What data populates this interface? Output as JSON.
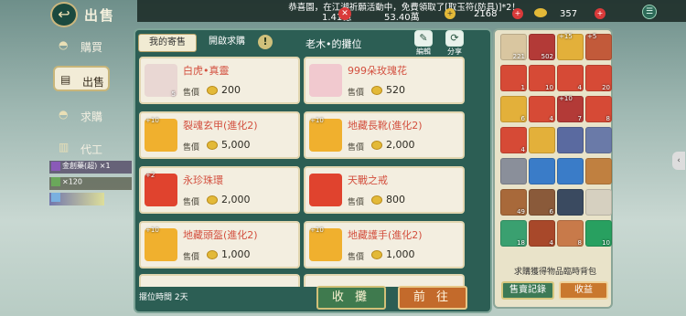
{
  "top": {
    "notice": "恭喜園，在江湖祈願活動中，免費領取了[取玉符(防具)]*2！",
    "currencies": [
      {
        "name": "silver",
        "value": "1.41億"
      },
      {
        "name": "copper",
        "value": "53.40萬"
      },
      {
        "name": "jade",
        "value": "2168"
      },
      {
        "name": "gold",
        "value": "357"
      }
    ]
  },
  "title": "出售",
  "nav": [
    {
      "label": "購買",
      "icon": "bowl-icon"
    },
    {
      "label": "出售",
      "icon": "register-icon"
    },
    {
      "label": "求購",
      "icon": "bowl-icon"
    },
    {
      "label": "代工",
      "icon": "anvil-icon"
    }
  ],
  "side_items": [
    {
      "label": "金創藥(超) ×1"
    },
    {
      "label": "×120"
    }
  ],
  "tabs": {
    "mine": "我的寄售",
    "open": "開啟求購"
  },
  "stall_title": "老木•的攤位",
  "edit_label": "編輯",
  "share_label": "分享",
  "price_label": "售價",
  "listings": [
    {
      "name": "白虎•真靈",
      "price": "200",
      "qty": "5",
      "plus": "",
      "color": "#e9d7d3"
    },
    {
      "name": "999朵玫瑰花",
      "price": "520",
      "qty": "",
      "plus": "",
      "color": "#f1c9cf"
    },
    {
      "name": "裂魂玄甲(進化2)",
      "price": "5,000",
      "qty": "",
      "plus": "+10",
      "color": "#f0b02e"
    },
    {
      "name": "地藏長靴(進化2)",
      "price": "2,000",
      "qty": "",
      "plus": "+10",
      "color": "#f0b02e"
    },
    {
      "name": "永珍珠環",
      "price": "2,000",
      "qty": "",
      "plus": "+2",
      "color": "#e0432e"
    },
    {
      "name": "天戰之戒",
      "price": "800",
      "qty": "",
      "plus": "",
      "color": "#e0432e"
    },
    {
      "name": "地藏頭盔(進化2)",
      "price": "1,000",
      "qty": "",
      "plus": "+10",
      "color": "#f0b02e"
    },
    {
      "name": "地藏護手(進化2)",
      "price": "1,000",
      "qty": "",
      "plus": "+10",
      "color": "#f0b02e"
    }
  ],
  "stall_time": "擺位時間 2天",
  "buttons": {
    "collect": "收 攤",
    "go": "前 往",
    "sales_log": "售賣記錄",
    "income": "收益"
  },
  "inventory_caption": "求購獲得物品臨時背包",
  "inventory": [
    {
      "color": "#d9c6a0",
      "qty": "221",
      "plus": ""
    },
    {
      "color": "#b33a37",
      "qty": "502",
      "plus": ""
    },
    {
      "color": "#e3b03a",
      "qty": "",
      "plus": "+15"
    },
    {
      "color": "#c25a3a",
      "qty": "",
      "plus": "+5"
    },
    {
      "color": "#d64a36",
      "qty": "1",
      "plus": ""
    },
    {
      "color": "#d64a36",
      "qty": "10",
      "plus": ""
    },
    {
      "color": "#d64a36",
      "qty": "4",
      "plus": ""
    },
    {
      "color": "#d64a36",
      "qty": "20",
      "plus": ""
    },
    {
      "color": "#e3b03a",
      "qty": "6",
      "plus": ""
    },
    {
      "color": "#d64a36",
      "qty": "4",
      "plus": ""
    },
    {
      "color": "#b33a37",
      "qty": "7",
      "plus": "+10"
    },
    {
      "color": "#d64a36",
      "qty": "8",
      "plus": ""
    },
    {
      "color": "#d64a36",
      "qty": "4",
      "plus": ""
    },
    {
      "color": "#e3b03a",
      "qty": "",
      "plus": ""
    },
    {
      "color": "#5a6aa0",
      "qty": "",
      "plus": ""
    },
    {
      "color": "#6a7aa8",
      "qty": "",
      "plus": ""
    },
    {
      "color": "#8a8f9a",
      "qty": "",
      "plus": ""
    },
    {
      "color": "#3a7cc8",
      "qty": "",
      "plus": ""
    },
    {
      "color": "#3a7cc8",
      "qty": "",
      "plus": ""
    },
    {
      "color": "#c08040",
      "qty": "",
      "plus": ""
    },
    {
      "color": "#a8693a",
      "qty": "49",
      "plus": ""
    },
    {
      "color": "#8a5a3a",
      "qty": "6",
      "plus": ""
    },
    {
      "color": "#3a4a60",
      "qty": "",
      "plus": ""
    },
    {
      "color": "#d6d0c0",
      "qty": "",
      "plus": ""
    },
    {
      "color": "#3aa070",
      "qty": "18",
      "plus": ""
    },
    {
      "color": "#a8482a",
      "qty": "4",
      "plus": ""
    },
    {
      "color": "#c87a4a",
      "qty": "8",
      "plus": ""
    },
    {
      "color": "#28a060",
      "qty": "10",
      "plus": ""
    }
  ]
}
